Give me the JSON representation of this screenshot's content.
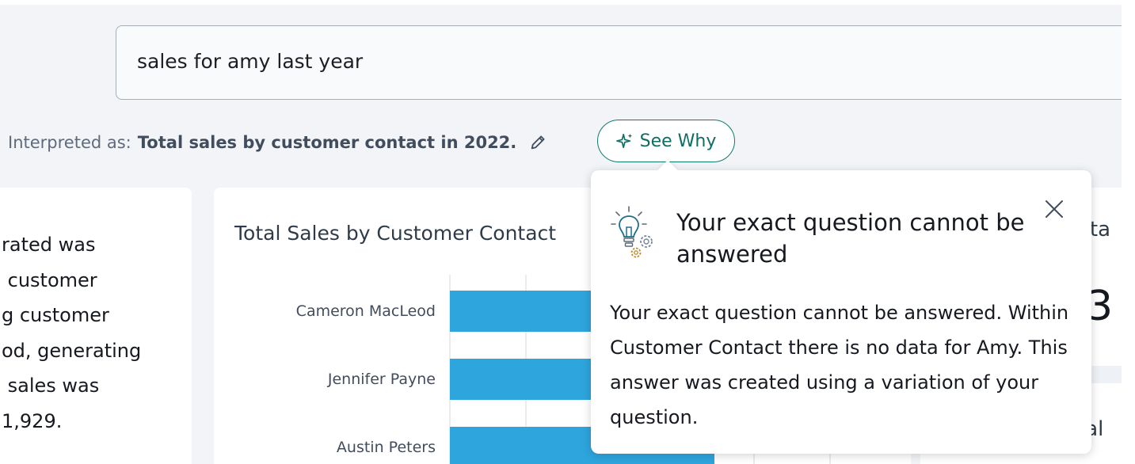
{
  "search": {
    "query": "sales for amy last year"
  },
  "interpretation": {
    "prefix": "Interpreted as:",
    "text": "Total sales by customer contact in 2022.",
    "see_why_label": "See Why"
  },
  "narrative": {
    "lines": [
      "rated was",
      " customer",
      "g customer",
      "od, generating",
      " sales was",
      "1,929."
    ]
  },
  "chart": {
    "title": "Total Sales by Customer Contact"
  },
  "chart_data": {
    "type": "bar",
    "orientation": "horizontal",
    "title": "Total Sales by Customer Contact",
    "categories": [
      "Cameron MacLeod",
      "Jennifer Payne",
      "Austin Peters"
    ],
    "values": [
      null,
      null,
      null
    ],
    "xlabel": "",
    "ylabel": "",
    "grid": true,
    "bar_color": "#2ea5dd"
  },
  "kpi": {
    "title_partial": "ota",
    "value_partial": "3",
    "title2_partial": "tal"
  },
  "popover": {
    "title": "Your exact question cannot be answered",
    "body": "Your exact question cannot be answered. Within Customer Contact there is no data for Amy. This answer was created using a variation of your question.",
    "icon": "lightbulb-gears-icon",
    "close_icon": "close-icon"
  },
  "colors": {
    "accent": "#0f7b6c",
    "bar": "#2ea5dd",
    "background": "#f2f4f8"
  }
}
